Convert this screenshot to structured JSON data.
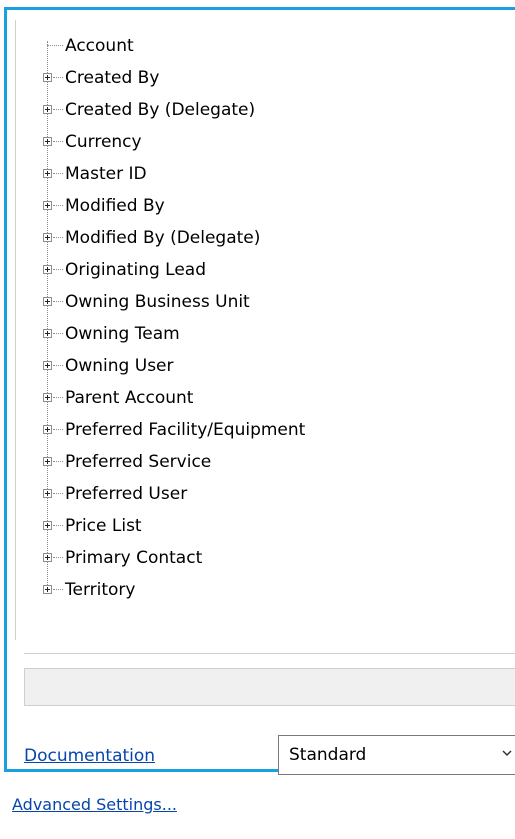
{
  "tree": {
    "root": "Account",
    "children": [
      "Created By",
      "Created By (Delegate)",
      "Currency",
      "Master ID",
      "Modified By",
      "Modified By (Delegate)",
      "Originating Lead",
      "Owning Business Unit",
      "Owning Team",
      "Owning User",
      "Parent Account",
      "Preferred Facility/Equipment",
      "Preferred Service",
      "Preferred User",
      "Price List",
      "Primary Contact",
      "Territory"
    ]
  },
  "status_text": "",
  "documentation_link": "Documentation",
  "mode_select": {
    "value": "Standard"
  },
  "advanced_settings_link": "Advanced Settings...",
  "colors": {
    "frame_border": "#1aa0e0",
    "link": "#0645ad"
  }
}
